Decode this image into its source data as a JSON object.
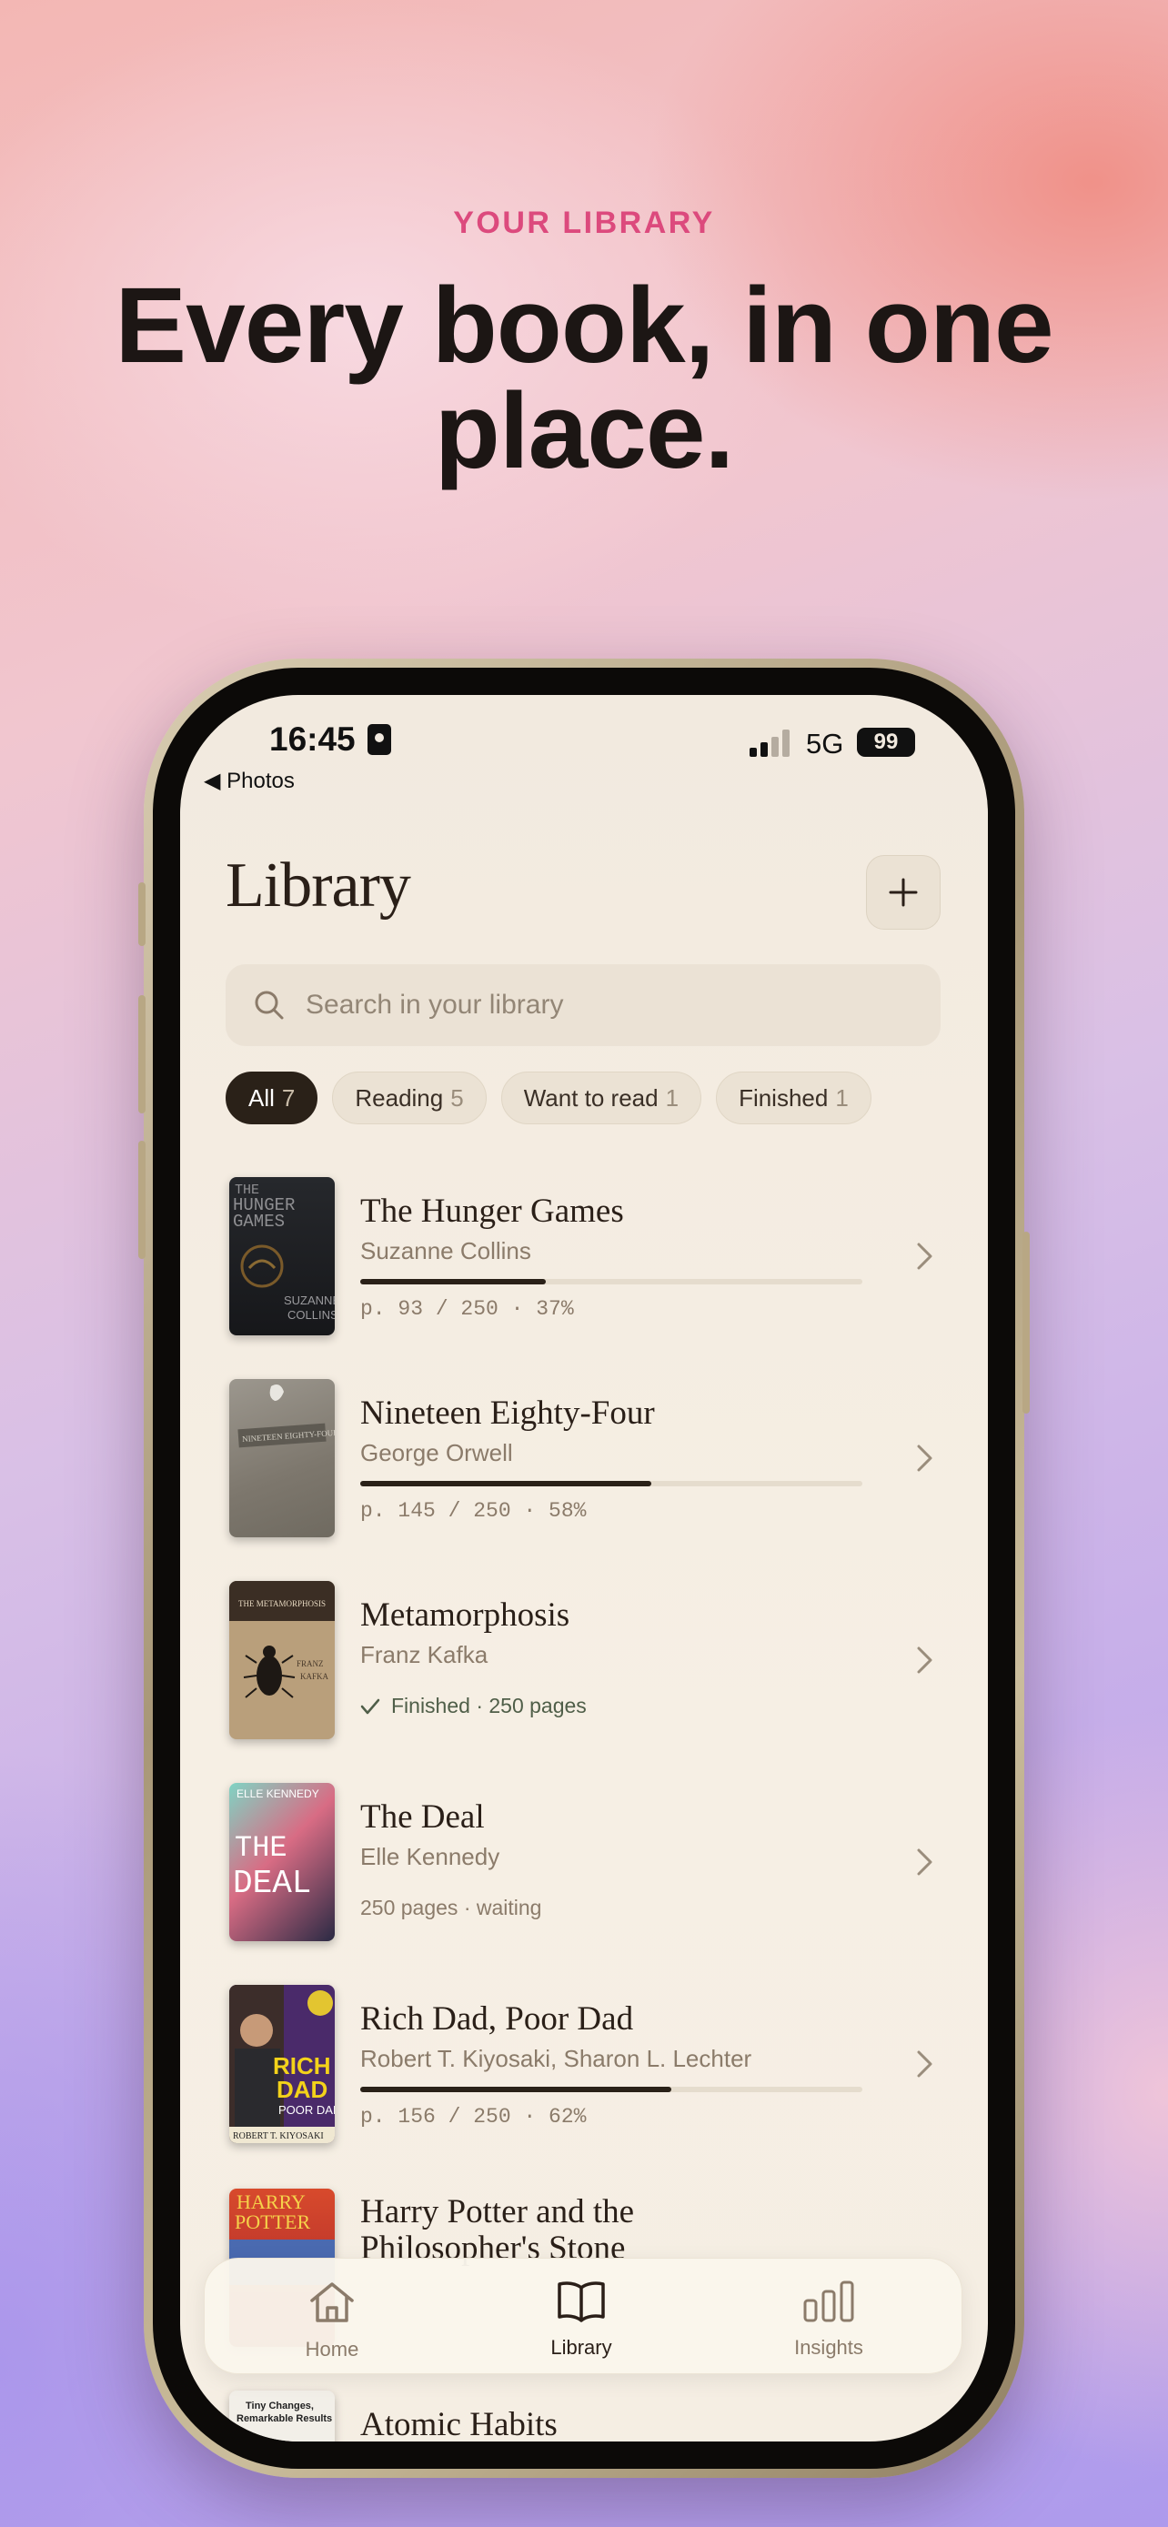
{
  "hero": {
    "eyebrow": "YOUR LIBRARY",
    "headline": "Every book, in one place."
  },
  "status_bar": {
    "time": "16:45",
    "back_label": "◀ Photos",
    "network": "5G",
    "battery": "99"
  },
  "header": {
    "title": "Library",
    "add_icon": "plus-icon"
  },
  "search": {
    "placeholder": "Search in your library",
    "icon": "search-icon"
  },
  "filters": [
    {
      "label": "All",
      "count": "7",
      "active": true
    },
    {
      "label": "Reading",
      "count": "5",
      "active": false
    },
    {
      "label": "Want to read",
      "count": "1",
      "active": false
    },
    {
      "label": "Finished",
      "count": "1",
      "active": false
    }
  ],
  "books": [
    {
      "title": "The Hunger Games",
      "author": "Suzanne Collins",
      "status": "reading",
      "progress": 0.37,
      "progress_text": "p. 93 / 250 · 37%"
    },
    {
      "title": "Nineteen Eighty-Four",
      "author": "George Orwell",
      "status": "reading",
      "progress": 0.58,
      "progress_text": "p. 145 / 250 · 58%"
    },
    {
      "title": "Metamorphosis",
      "author": "Franz Kafka",
      "status": "finished",
      "meta_text": "Finished · 250 pages"
    },
    {
      "title": "The Deal",
      "author": "Elle Kennedy",
      "status": "waiting",
      "meta_text": "250 pages · waiting"
    },
    {
      "title": "Rich Dad, Poor Dad",
      "author": "Robert T. Kiyosaki, Sharon L. Lechter",
      "status": "reading",
      "progress": 0.62,
      "progress_text": "p. 156 / 250 · 62%"
    },
    {
      "title": "Harry Potter and the Philosopher's Stone",
      "title_line1": "Harry Potter and the",
      "title_line2": "Philosopher's Stone"
    },
    {
      "title": "Atomic Habits"
    }
  ],
  "covers": {
    "hunger_games": {
      "line1": "THE",
      "line2": "HUNGER",
      "line3": "GAMES",
      "author1": "SUZANNE",
      "author2": "COLLINS"
    },
    "nineteen_eighty_four": {
      "label": "NINETEEN EIGHTY-FOUR"
    },
    "metamorphosis": {
      "title": "THE METAMORPHOSIS",
      "author1": "FRANZ",
      "author2": "KAFKA"
    },
    "the_deal": {
      "author": "ELLE KENNEDY",
      "line1": "THE",
      "line2": "DEAL"
    },
    "rich_dad": {
      "line1": "RICH",
      "line2": "DAD",
      "line3": "POOR DAD",
      "author": "ROBERT T. KIYOSAKI"
    },
    "harry_potter": {
      "line1": "HARRY",
      "line2": "POTTER"
    },
    "atomic_habits": {
      "line1": "Tiny Changes,",
      "line2": "Remarkable Results"
    }
  },
  "tabs": [
    {
      "label": "Home",
      "icon": "home-icon",
      "active": false
    },
    {
      "label": "Library",
      "icon": "book-open-icon",
      "active": true
    },
    {
      "label": "Insights",
      "icon": "bar-chart-icon",
      "active": false
    }
  ],
  "colors": {
    "accent": "#dc4a7d",
    "ink": "#2a1f18",
    "muted": "#8b7b6a",
    "screen_bg": "#f4ede2"
  }
}
